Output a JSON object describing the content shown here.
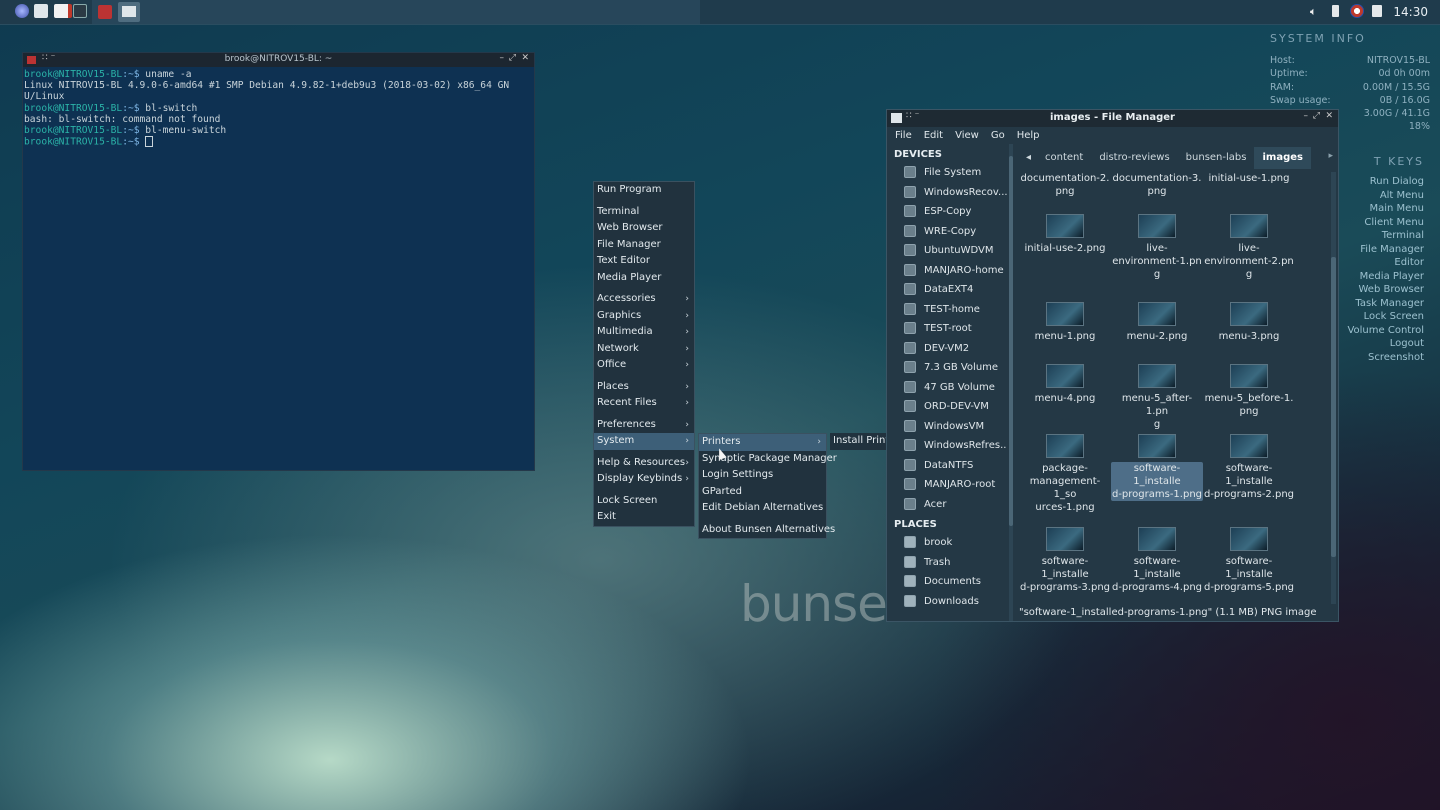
{
  "panel": {
    "clock": "14:30",
    "launchers": [
      "bunsenlabs-menu-icon",
      "file-manager-icon",
      "text-editor-icon",
      "terminal-icon"
    ],
    "tasks": [
      "terminal-task-icon",
      "file-manager-task-icon"
    ]
  },
  "conky": {
    "header": "SYSTEM INFO",
    "rows": [
      {
        "k": "Host:",
        "v": "NITROV15-BL"
      },
      {
        "k": "Uptime:",
        "v": "0d 0h 00m"
      },
      {
        "k": "RAM:",
        "v": "0.00M / 15.5G"
      },
      {
        "k": "Swap usage:",
        "v": "0B / 16.0G"
      },
      {
        "k": "",
        "v": "3.00G / 41.1G"
      },
      {
        "k": "",
        "v": "18%"
      }
    ],
    "keys_header": "T KEYS",
    "keys": [
      "Run Dialog",
      "Alt Menu",
      "Main Menu",
      "Client Menu",
      "Terminal",
      "File Manager",
      "Editor",
      "Media Player",
      "Web Browser",
      "Task Manager",
      "Lock Screen",
      "Volume Control",
      "Logout",
      "Screenshot"
    ]
  },
  "terminal": {
    "title": "brook@NITROV15-BL: ~",
    "prompt_user": "brook@NITROV15-BL",
    "prompt_path": ":~$",
    "lines": [
      {
        "type": "cmd",
        "text": " uname -a"
      },
      {
        "type": "out",
        "text": "Linux NITROV15-BL 4.9.0-6-amd64 #1 SMP Debian 4.9.82-1+deb9u3 (2018-03-02) x86_64 GN"
      },
      {
        "type": "out",
        "text": "U/Linux"
      },
      {
        "type": "cmd",
        "text": " bl-switch"
      },
      {
        "type": "out",
        "text": "bash: bl-switch: command not found"
      },
      {
        "type": "cmd",
        "text": " bl-menu-switch"
      },
      {
        "type": "cmd",
        "text": " "
      }
    ]
  },
  "root_menu": [
    {
      "label": "Run Program"
    },
    {
      "sep": true
    },
    {
      "label": "Terminal"
    },
    {
      "label": "Web Browser"
    },
    {
      "label": "File Manager"
    },
    {
      "label": "Text Editor"
    },
    {
      "label": "Media Player"
    },
    {
      "sep": true
    },
    {
      "label": "Accessories",
      "sub": true
    },
    {
      "label": "Graphics",
      "sub": true
    },
    {
      "label": "Multimedia",
      "sub": true
    },
    {
      "label": "Network",
      "sub": true
    },
    {
      "label": "Office",
      "sub": true
    },
    {
      "sep": true
    },
    {
      "label": "Places",
      "sub": true
    },
    {
      "label": "Recent Files",
      "sub": true
    },
    {
      "sep": true
    },
    {
      "label": "Preferences",
      "sub": true
    },
    {
      "label": "System",
      "sub": true,
      "selected": true
    },
    {
      "sep": true
    },
    {
      "label": "Help & Resources",
      "sub": true
    },
    {
      "label": "Display Keybinds",
      "sub": true
    },
    {
      "sep": true
    },
    {
      "label": "Lock Screen"
    },
    {
      "label": "Exit"
    }
  ],
  "system_menu": [
    {
      "label": "Printers",
      "sub": true,
      "selected": true
    },
    {
      "label": "Synaptic Package Manager"
    },
    {
      "label": "Login Settings"
    },
    {
      "label": "GParted"
    },
    {
      "label": "Edit Debian Alternatives"
    },
    {
      "sep": true
    },
    {
      "label": "About Bunsen Alternatives"
    }
  ],
  "printers_menu": [
    {
      "label": "Install Printing Support"
    }
  ],
  "filemanager": {
    "title": "images - File Manager",
    "menubar": [
      "File",
      "Edit",
      "View",
      "Go",
      "Help"
    ],
    "devices_header": "DEVICES",
    "devices": [
      "File System",
      "WindowsRecov...",
      "ESP-Copy",
      "WRE-Copy",
      "UbuntuWDVM",
      "MANJARO-home",
      "DataEXT4",
      "TEST-home",
      "TEST-root",
      "DEV-VM2",
      "7.3 GB Volume",
      "47 GB Volume",
      "ORD-DEV-VM",
      "WindowsVM",
      "WindowsRefres...",
      "DataNTFS",
      "MANJARO-root",
      "Acer"
    ],
    "places_header": "PLACES",
    "places": [
      "brook",
      "Trash",
      "Documents",
      "Downloads"
    ],
    "breadcrumb": [
      "content",
      "distro-reviews",
      "bunsen-labs",
      "images"
    ],
    "files": [
      [
        "documentation-2.\npng",
        "documentation-3.\npng",
        "initial-use-1.png"
      ],
      [
        "initial-use-2.png",
        "live-\nenvironment-1.pn\ng",
        "live-\nenvironment-2.pn\ng"
      ],
      [
        "menu-1.png",
        "menu-2.png",
        "menu-3.png"
      ],
      [
        "menu-4.png",
        "menu-5_after-1.pn\ng",
        "menu-5_before-1.\npng"
      ],
      [
        "package-\nmanagement-1_so\nurces-1.png",
        "software-1_installe\nd-programs-1.png",
        "software-1_installe\nd-programs-2.png"
      ],
      [
        "software-1_installe\nd-programs-3.png",
        "software-1_installe\nd-programs-4.png",
        "software-1_installe\nd-programs-5.png"
      ]
    ],
    "selected_file": "software-1_installe\nd-programs-1.png",
    "status": "\"software-1_installed-programs-1.png\" (1.1 MB) PNG image"
  },
  "wallpaper_text": "bunsenlabs"
}
